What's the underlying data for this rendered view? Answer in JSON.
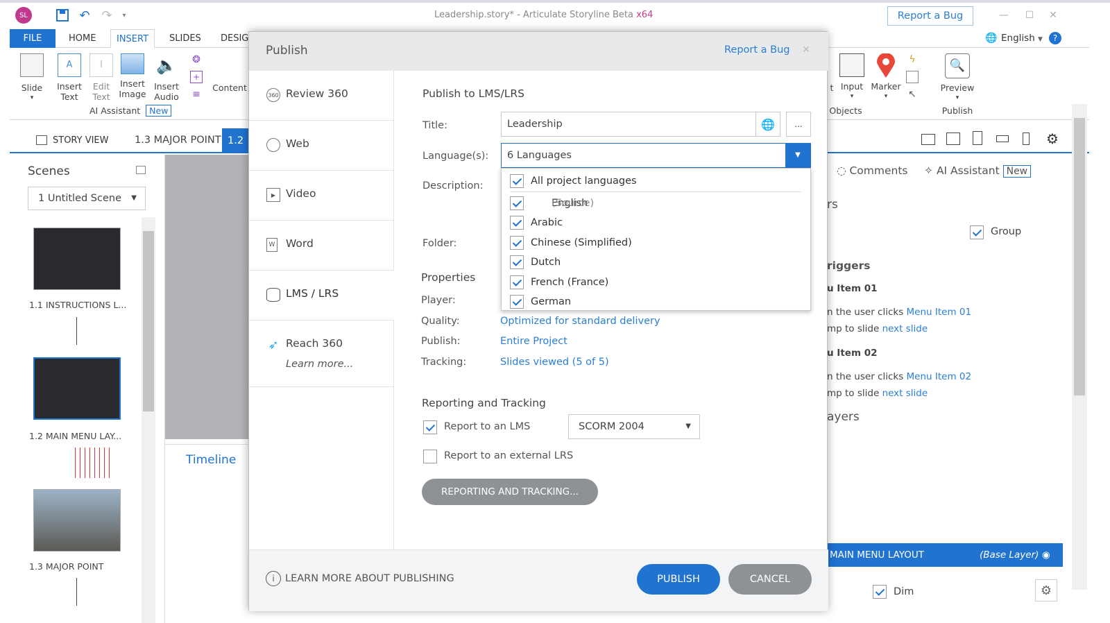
{
  "app": {
    "window_title": "Leadership.story* - Articulate Storyline Beta",
    "arch": "x64",
    "report_bug": "Report a Bug",
    "language": "English",
    "user_initials": "SL"
  },
  "ribbon_tabs": [
    "FILE",
    "HOME",
    "INSERT",
    "SLIDES",
    "DESIGN"
  ],
  "ribbon": {
    "slide": "Slide",
    "insert_text": "Insert Text",
    "edit_text": "Edit Text",
    "insert_image": "Insert Image",
    "insert_audio": "Insert Audio",
    "ai_assistant": "AI Assistant",
    "new_badge": "New",
    "content": "Content",
    "objects_partial": "t",
    "input": "Input",
    "marker": "Marker",
    "objects_group": "Objects",
    "preview": "Preview",
    "publish_group": "Publish"
  },
  "viewbar": {
    "story_view": "STORY VIEW",
    "tab1": "1.3 MAJOR POINT",
    "tab2": "1.2"
  },
  "scenes": {
    "title": "Scenes",
    "dropdown": "1 Untitled Scene",
    "slides": [
      "1.1 INSTRUCTIONS L...",
      "1.2 MAIN MENU LAY...",
      "1.3 MAJOR POINT"
    ]
  },
  "timeline": {
    "title": "Timeline"
  },
  "right_panel": {
    "comments": "Comments",
    "ai_assistant": "AI Assistant",
    "new_badge": "New",
    "states_partial": "rs",
    "group": "Group",
    "triggers_title": "riggers",
    "menu_item_01": "u Item 01",
    "trigger1_line1a": "n the user clicks ",
    "trigger1_line1b": "Menu Item 01",
    "trigger1_line2a": "mp to slide ",
    "trigger1_line2b": "next slide",
    "menu_item_02": "u Item 02",
    "trigger2_line1a": "n the user clicks ",
    "trigger2_line1b": "Menu Item 02",
    "trigger2_line2a": "mp to slide ",
    "trigger2_line2b": "next slide",
    "layers_title": "ayers",
    "base_layer_name": "MAIN MENU LAYOUT",
    "base_layer_tag": "(Base Layer)",
    "dim": "Dim"
  },
  "dialog": {
    "title": "Publish",
    "report_bug": "Report a Bug",
    "targets": [
      "Review 360",
      "Web",
      "Video",
      "Word",
      "LMS / LRS",
      "Reach 360"
    ],
    "learn_more_link": "Learn more...",
    "section_title": "Publish to LMS/LRS",
    "title_label": "Title:",
    "title_value": "Leadership",
    "languages_label": "Language(s):",
    "languages_value": "6 Languages",
    "description_label": "Description:",
    "folder_label": "Folder:",
    "languages_options": [
      {
        "label": "All project languages",
        "checked": true
      },
      {
        "label": "English",
        "suffix": "(Source)",
        "checked": true
      },
      {
        "label": "Arabic",
        "checked": true
      },
      {
        "label": "Chinese (Simplified)",
        "checked": true
      },
      {
        "label": "Dutch",
        "checked": true
      },
      {
        "label": "French (France)",
        "checked": true
      },
      {
        "label": "German",
        "checked": true
      }
    ],
    "properties_title": "Properties",
    "player_label": "Player:",
    "quality_label": "Quality:",
    "quality_value": "Optimized for standard delivery",
    "publish_label": "Publish:",
    "publish_value": "Entire Project",
    "tracking_label": "Tracking:",
    "tracking_value": "Slides viewed (5 of 5)",
    "reporting_title": "Reporting and Tracking",
    "report_lms_label": "Report to an LMS",
    "report_lms_checked": true,
    "lms_standard": "SCORM 2004",
    "report_lrs_label": "Report to an external LRS",
    "report_lrs_checked": false,
    "reporting_button": "REPORTING AND TRACKING...",
    "learn_more_publishing": "LEARN MORE ABOUT PUBLISHING",
    "publish_button": "PUBLISH",
    "cancel_button": "CANCEL"
  },
  "colors": {
    "accent": "#2173d0",
    "link": "#2a7fd4",
    "cancel_gray": "#8e9297",
    "overlay": "#5a5c60"
  }
}
